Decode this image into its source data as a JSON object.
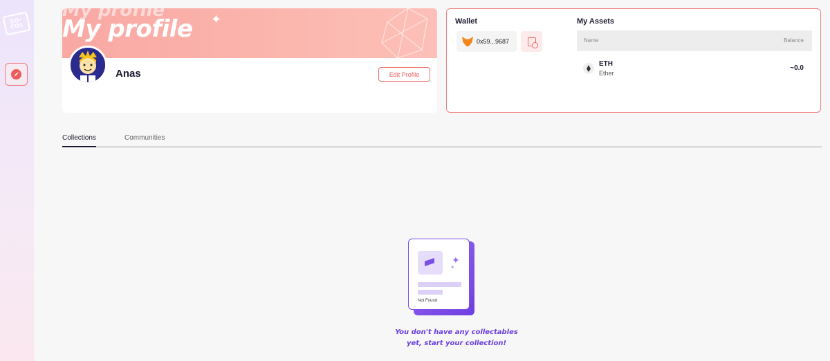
{
  "sidebar": {
    "logo_text": "SO- COL",
    "nav_icon": "compass-icon"
  },
  "profile": {
    "banner_ghost_text": "My profile",
    "banner_title": "My profile",
    "name": "Anas",
    "edit_button_label": "Edit Profile"
  },
  "wallet": {
    "title": "Wallet",
    "address": "0x59...9687",
    "wallet_icon": "metamask-fox-icon",
    "history_icon": "history-icon"
  },
  "assets": {
    "title": "My Assets",
    "columns": {
      "name": "Name",
      "balance": "Balance"
    },
    "rows": [
      {
        "symbol": "ETH",
        "name": "Ether",
        "balance": "~0.0",
        "icon": "ethereum-icon"
      }
    ]
  },
  "tabs": [
    {
      "label": "Collections",
      "active": true
    },
    {
      "label": "Communities",
      "active": false
    }
  ],
  "empty_state": {
    "card_label": "Not Found",
    "message_line1": "You don't have any collectables",
    "message_line2": "yet, start your collection!"
  },
  "colors": {
    "accent": "#ef5b5b",
    "purple": "#6a3ce0",
    "banner": "#f9a8a3"
  }
}
